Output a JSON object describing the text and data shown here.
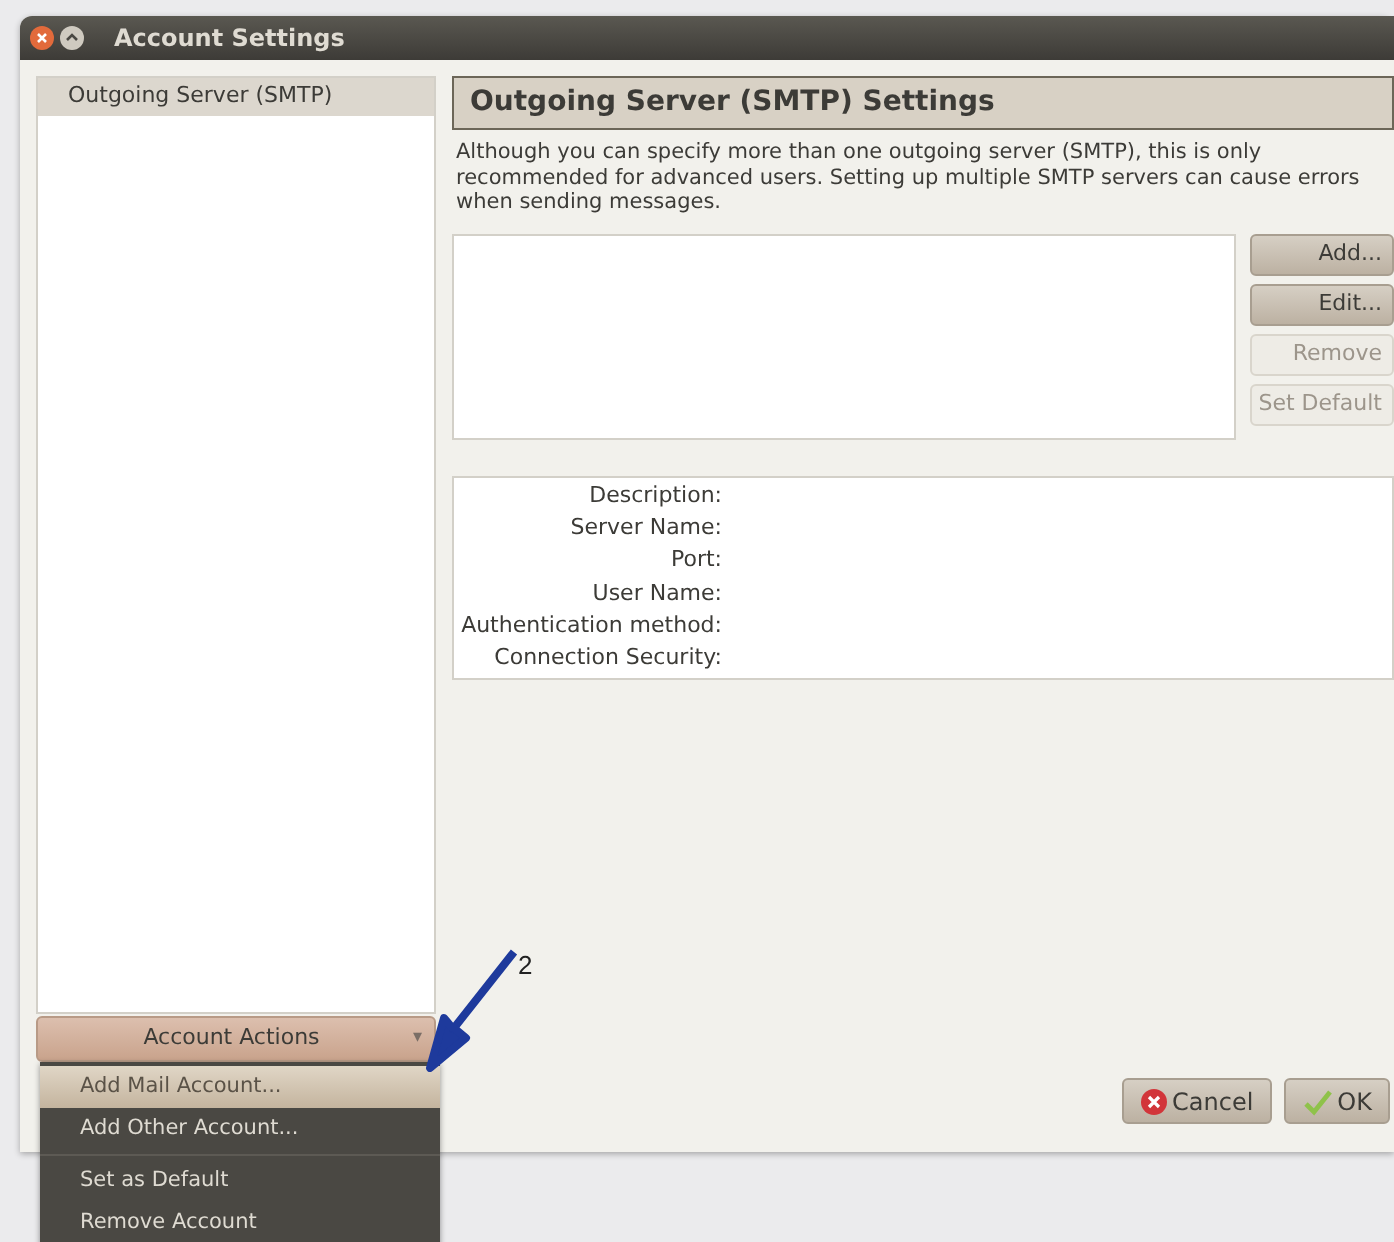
{
  "window": {
    "title": "Account Settings"
  },
  "sidebar": {
    "items": [
      {
        "label": "Outgoing Server (SMTP)",
        "selected": true
      }
    ],
    "actions_button": "Account Actions",
    "actions_caret": "▾"
  },
  "actions_menu": {
    "items": [
      {
        "label": "Add Mail Account...",
        "selected": true,
        "separator_after": false
      },
      {
        "label": "Add Other Account...",
        "selected": false,
        "separator_after": true
      },
      {
        "label": "Set as Default",
        "selected": false,
        "separator_after": false
      },
      {
        "label": "Remove Account",
        "selected": false,
        "separator_after": false
      }
    ]
  },
  "panel": {
    "heading": "Outgoing Server (SMTP) Settings",
    "description": "Although you can specify more than one outgoing server (SMTP), this is only recommended for advanced users. Setting up multiple SMTP servers can cause errors when sending messages.",
    "buttons": [
      {
        "label": "Add...",
        "disabled": false
      },
      {
        "label": "Edit...",
        "disabled": false
      },
      {
        "label": "Remove",
        "disabled": true
      },
      {
        "label": "Set Default",
        "disabled": true
      }
    ],
    "details": [
      "Description:",
      "Server Name:",
      "Port:",
      "User Name:",
      "Authentication method:",
      "Connection Security:"
    ]
  },
  "footer_buttons": [
    {
      "label": "Cancel",
      "kind": "cancel"
    },
    {
      "label": "OK",
      "kind": "ok"
    }
  ],
  "annotation": {
    "label": "2"
  }
}
